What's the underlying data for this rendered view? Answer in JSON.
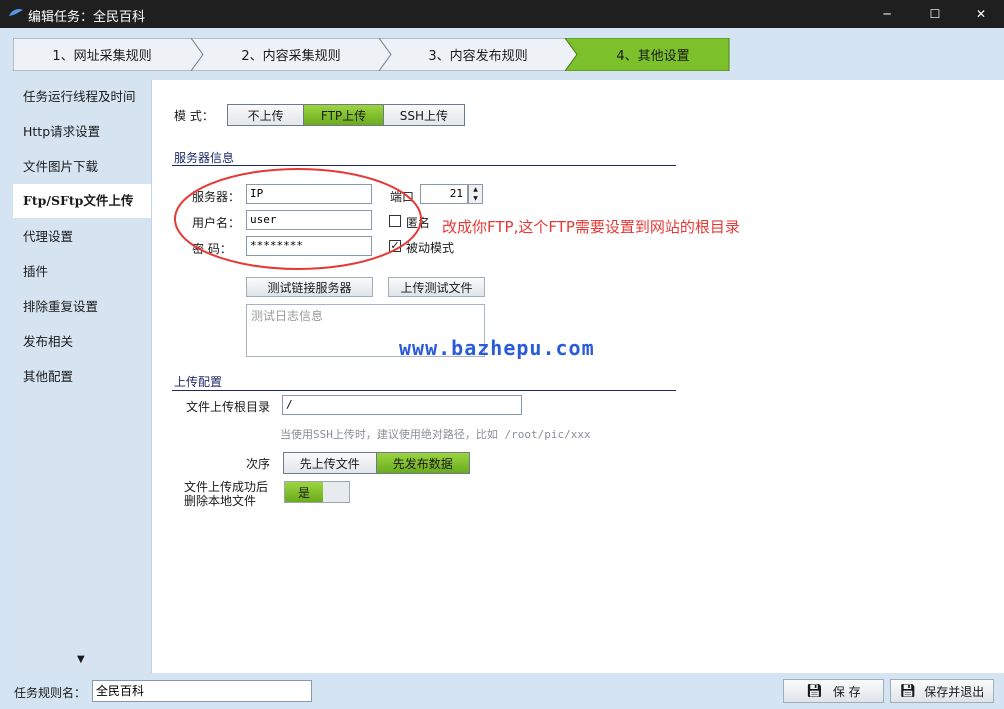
{
  "window": {
    "title": "编辑任务：全民百科",
    "minimize": "─",
    "maximize": "☐",
    "close": "✕"
  },
  "steps": [
    {
      "label": "1、网址采集规则",
      "selected": false
    },
    {
      "label": "2、内容采集规则",
      "selected": false
    },
    {
      "label": "3、内容发布规则",
      "selected": false
    },
    {
      "label": "4、其他设置",
      "selected": true
    }
  ],
  "sidebar": {
    "items": [
      {
        "label": "任务运行线程及时间"
      },
      {
        "label": "Http请求设置"
      },
      {
        "label": "文件图片下载"
      },
      {
        "label": "Ftp/SFtp文件上传",
        "active": true
      },
      {
        "label": "代理设置"
      },
      {
        "label": "插件"
      },
      {
        "label": "排除重复设置"
      },
      {
        "label": "发布相关"
      },
      {
        "label": "其他配置"
      }
    ],
    "scroll_arrow": "▼"
  },
  "mode": {
    "label": "模  式：",
    "options": [
      "不上传",
      "FTP上传",
      "SSH上传"
    ],
    "selected": "FTP上传"
  },
  "server": {
    "section": "服务器信息",
    "server_label": "服务器：",
    "server_value": "IP",
    "port_label": "端口",
    "port_value": "21",
    "user_label": "用户名：",
    "user_value": "user",
    "anonymous_label": "匿名",
    "anonymous_checked": false,
    "password_label": "密  码：",
    "password_value": "********",
    "passive_label": "被动模式",
    "passive_checked": true,
    "test_connect_btn": "测试链接服务器",
    "upload_test_btn": "上传测试文件",
    "log_placeholder": "测试日志信息"
  },
  "annotation": {
    "text": "改成你FTP,这个FTP需要设置到网站的根目录",
    "color": "#e53935"
  },
  "watermark": "www.bazhepu.com",
  "upload": {
    "section": "上传配置",
    "root_label": "文件上传根目录",
    "root_value": "/",
    "hint": "当使用SSH上传时，建议使用绝对路径，比如  /root/pic/xxx",
    "order_label": "次序",
    "order_options": [
      "先上传文件",
      "先发布数据"
    ],
    "order_selected": "先发布数据",
    "delete_label_1": "文件上传成功后",
    "delete_label_2": "删除本地文件",
    "delete_value": "是"
  },
  "footer": {
    "rule_name_label": "任务规则名：",
    "rule_name_value": "全民百科",
    "save_btn": "保 存",
    "save_exit_btn": "保存并退出"
  },
  "colors": {
    "accent_green": "#7cc02c",
    "frame_blue": "#d5e4f2",
    "section_navy": "#1b2a66",
    "annotation_red": "#e53935"
  }
}
